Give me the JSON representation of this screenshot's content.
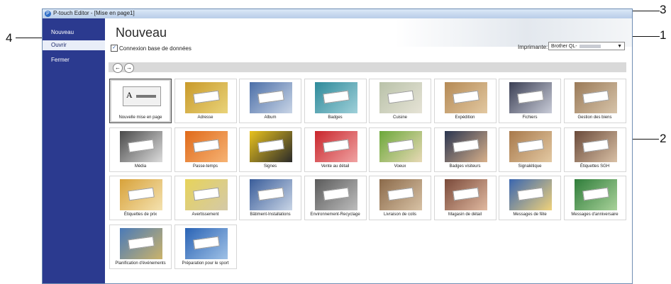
{
  "callouts": {
    "c1": "1",
    "c2": "2",
    "c3": "3",
    "c4": "4"
  },
  "window": {
    "title": "P-touch Editor - [Mise en page1]"
  },
  "sidebar": {
    "items": [
      {
        "label": "Nouveau",
        "active": true
      },
      {
        "label": "Ouvrir",
        "active": false
      },
      {
        "label": "Fermer",
        "active": false
      }
    ]
  },
  "main": {
    "title": "Nouveau",
    "db_label": "Connexion base de données",
    "printer_label": "Imprimante:",
    "printer_value": "Brother QL-"
  },
  "templates": [
    {
      "label": "Nouvelle mise en page",
      "colors": [
        "#f3f3f3",
        "#dcdcdc"
      ],
      "kind": "blank"
    },
    {
      "label": "Adresse",
      "colors": [
        "#c99a2a",
        "#e9d37a"
      ]
    },
    {
      "label": "Album",
      "colors": [
        "#4c6fa8",
        "#c9d5e6"
      ]
    },
    {
      "label": "Badges",
      "colors": [
        "#2e8a9a",
        "#9fd0d9"
      ]
    },
    {
      "label": "Cuisine",
      "colors": [
        "#b9c2a9",
        "#e6e3d6"
      ]
    },
    {
      "label": "Expédition",
      "colors": [
        "#b58a55",
        "#e2c8a1"
      ]
    },
    {
      "label": "Fichiers",
      "colors": [
        "#3b3f54",
        "#c9ccd8"
      ]
    },
    {
      "label": "Gestion des biens",
      "colors": [
        "#9a7a58",
        "#d7c4aa"
      ]
    },
    {
      "label": "Média",
      "colors": [
        "#4a4a4a",
        "#dcdcdc"
      ]
    },
    {
      "label": "Passe-temps",
      "colors": [
        "#e06a1a",
        "#f6b374"
      ]
    },
    {
      "label": "Signes",
      "colors": [
        "#e9c21d",
        "#2a2a2a"
      ]
    },
    {
      "label": "Vente au détail",
      "colors": [
        "#c9262c",
        "#f0a3a3"
      ]
    },
    {
      "label": "Voeux",
      "colors": [
        "#6ca83a",
        "#e8d9b6"
      ]
    },
    {
      "label": "Badges visiteurs",
      "colors": [
        "#2a3550",
        "#d8b08a"
      ]
    },
    {
      "label": "Signalétique",
      "colors": [
        "#a8794b",
        "#e3c9a3"
      ]
    },
    {
      "label": "Étiquettes SGH",
      "colors": [
        "#6a4a3a",
        "#d9c0a5"
      ]
    },
    {
      "label": "Étiquettes de prix",
      "colors": [
        "#d8a23a",
        "#f4e2b0"
      ]
    },
    {
      "label": "Avertissement",
      "colors": [
        "#e7d35a",
        "#d4c9a8"
      ]
    },
    {
      "label": "Bâtiment-Installations",
      "colors": [
        "#3a5d9a",
        "#c9d5e6"
      ]
    },
    {
      "label": "Environnement-Recyclage",
      "colors": [
        "#5b5b5b",
        "#bdbdbd"
      ]
    },
    {
      "label": "Livraison de colis",
      "colors": [
        "#8b6a4a",
        "#d8c2a5"
      ]
    },
    {
      "label": "Magasin de détail",
      "colors": [
        "#7a4a3a",
        "#e1b9a0"
      ]
    },
    {
      "label": "Messages de fête",
      "colors": [
        "#3a66b0",
        "#f0d27a"
      ]
    },
    {
      "label": "Messages d'anniversaire",
      "colors": [
        "#2f7d3a",
        "#a9d29a"
      ]
    },
    {
      "label": "Planification d'événements",
      "colors": [
        "#4a7ab8",
        "#cbb36a"
      ]
    },
    {
      "label": "Préparation pour le sport",
      "colors": [
        "#2a63b5",
        "#9fc1e6"
      ]
    }
  ],
  "colors": {
    "sidebar": "#2b3a8f",
    "accent_star": "#c0222e"
  }
}
